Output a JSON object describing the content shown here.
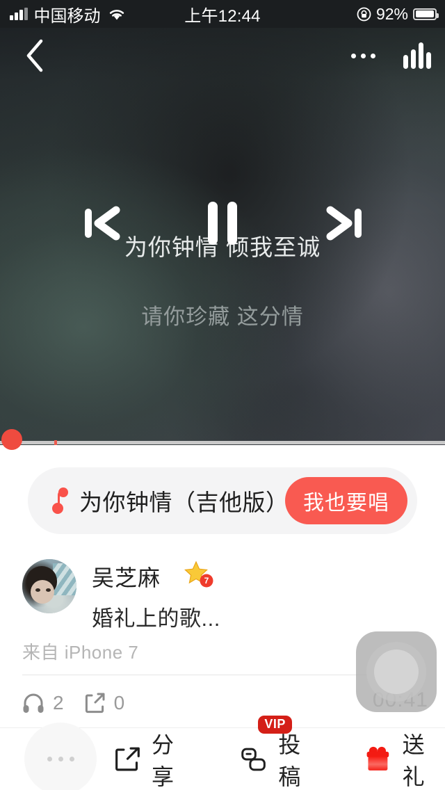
{
  "statusbar": {
    "signal_icon": "cellular-signal-icon",
    "carrier": "中国移动",
    "wifi_icon": "wifi-icon",
    "time": "上午12:44",
    "rotation_lock_icon": "rotation-lock-icon",
    "battery_percent": "92%",
    "battery_icon": "battery-icon"
  },
  "navbar": {
    "back_icon": "back-chevron-icon",
    "more_icon": "more-dots-icon",
    "equalizer_icon": "equalizer-icon"
  },
  "player": {
    "prev_icon": "previous-track-icon",
    "pause_icon": "pause-icon",
    "next_icon": "next-track-icon",
    "lyric_current": "为你钟情 倾我至诚",
    "lyric_next": "请你珍藏 这分情",
    "progress_percent": 0
  },
  "song_card": {
    "note_icon": "music-note-icon",
    "title": "为你钟情（吉他版）",
    "sing_button": "我也要唱",
    "accent_color": "#f95a51"
  },
  "user": {
    "avatar_icon": "user-avatar",
    "name": "吴芝麻",
    "level_icon": "star-level-badge-icon",
    "level": "7",
    "description": "婚礼上的歌...",
    "source": "来自 iPhone 7"
  },
  "stats": {
    "listen_icon": "headphone-icon",
    "listen_count": "2",
    "share_icon": "share-icon",
    "share_count": "0",
    "duration": "00:41"
  },
  "assistive_touch": {
    "icon": "assistive-touch-icon"
  },
  "bottombar": {
    "more_icon": "more-dots-icon",
    "items": [
      {
        "icon": "share-box-icon",
        "label": "分享",
        "badge": ""
      },
      {
        "icon": "submit-post-icon",
        "label": "投稿",
        "badge": "VIP"
      },
      {
        "icon": "gift-icon",
        "label": "送礼",
        "badge": ""
      }
    ]
  }
}
